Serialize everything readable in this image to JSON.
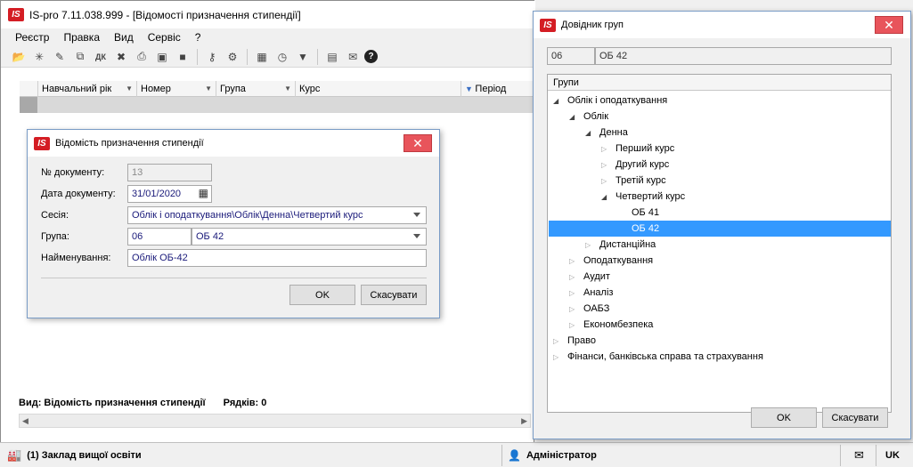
{
  "main": {
    "title": "IS-pro 7.11.038.999 - [Відомості призначення стипендії]",
    "menu": [
      "Реєстр",
      "Правка",
      "Вид",
      "Сервіс",
      "?"
    ],
    "grid_columns": [
      "Навчальний рік",
      "Номер",
      "Група",
      "Курс",
      "Період"
    ],
    "status_view": "Вид: Відомість призначення стипендії",
    "status_rows": "Рядків: 0"
  },
  "bottombar": {
    "institution": "(1) Заклад вищої освіти",
    "user": "Адміністратор",
    "lang": "UK"
  },
  "doc_dialog": {
    "title": "Відомість призначення стипендії",
    "doc_no_label": "№ документу:",
    "doc_no_value": "13",
    "doc_date_label": "Дата документу:",
    "doc_date_value": "31/01/2020",
    "session_label": "Сесія:",
    "session_value": "Облік і оподаткування\\Облік\\Денна\\Четвертий курс",
    "group_label": "Група:",
    "group_code": "06",
    "group_name": "ОБ 42",
    "name_label": "Найменування:",
    "name_value": "Облік ОБ-42",
    "ok": "OK",
    "cancel": "Скасувати"
  },
  "groups_dialog": {
    "title": "Довідник груп",
    "code": "06",
    "name": "ОБ 42",
    "tree_header": "Групи",
    "tree": [
      {
        "label": "Облік і оподаткування",
        "level": 0,
        "state": "expanded"
      },
      {
        "label": "Облік",
        "level": 1,
        "state": "expanded"
      },
      {
        "label": "Денна",
        "level": 2,
        "state": "expanded"
      },
      {
        "label": "Перший курс",
        "level": 3,
        "state": "collapsed"
      },
      {
        "label": "Другий курс",
        "level": 3,
        "state": "collapsed"
      },
      {
        "label": "Третій курс",
        "level": 3,
        "state": "collapsed"
      },
      {
        "label": "Четвертий курс",
        "level": 3,
        "state": "expanded"
      },
      {
        "label": "ОБ 41",
        "level": 4,
        "state": "leaf"
      },
      {
        "label": "ОБ 42",
        "level": 4,
        "state": "leaf",
        "selected": true
      },
      {
        "label": "Дистанційна",
        "level": 2,
        "state": "collapsed"
      },
      {
        "label": "Оподаткування",
        "level": 1,
        "state": "collapsed"
      },
      {
        "label": "Аудит",
        "level": 1,
        "state": "collapsed"
      },
      {
        "label": "Аналіз",
        "level": 1,
        "state": "collapsed"
      },
      {
        "label": "ОАБЗ",
        "level": 1,
        "state": "collapsed"
      },
      {
        "label": "Економбезпека",
        "level": 1,
        "state": "collapsed"
      },
      {
        "label": "Право",
        "level": 0,
        "state": "collapsed"
      },
      {
        "label": "Фінанси, банківська справа та страхування",
        "level": 0,
        "state": "collapsed"
      }
    ],
    "ok": "OK",
    "cancel": "Скасувати"
  },
  "colors": {
    "selection": "#3399ff",
    "close": "#e8545b",
    "logo": "#d41d24"
  }
}
